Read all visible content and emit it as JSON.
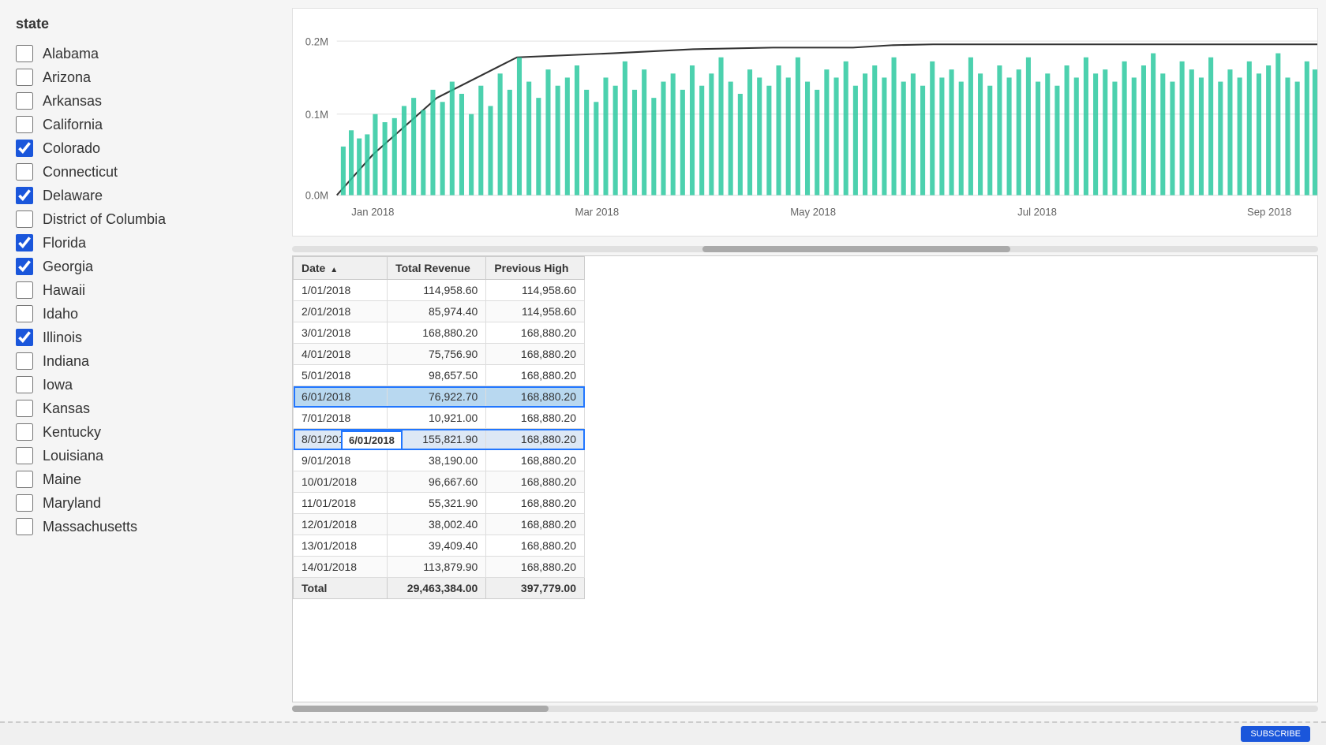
{
  "sidebar": {
    "title": "state",
    "states": [
      {
        "label": "Alabama",
        "checked": false
      },
      {
        "label": "Arizona",
        "checked": false
      },
      {
        "label": "Arkansas",
        "checked": false
      },
      {
        "label": "California",
        "checked": false
      },
      {
        "label": "Colorado",
        "checked": true
      },
      {
        "label": "Connecticut",
        "checked": false
      },
      {
        "label": "Delaware",
        "checked": true
      },
      {
        "label": "District of Columbia",
        "checked": false
      },
      {
        "label": "Florida",
        "checked": true
      },
      {
        "label": "Georgia",
        "checked": true
      },
      {
        "label": "Hawaii",
        "checked": false
      },
      {
        "label": "Idaho",
        "checked": false
      },
      {
        "label": "Illinois",
        "checked": true
      },
      {
        "label": "Indiana",
        "checked": false
      },
      {
        "label": "Iowa",
        "checked": false
      },
      {
        "label": "Kansas",
        "checked": false
      },
      {
        "label": "Kentucky",
        "checked": false
      },
      {
        "label": "Louisiana",
        "checked": false
      },
      {
        "label": "Maine",
        "checked": false
      },
      {
        "label": "Maryland",
        "checked": false
      },
      {
        "label": "Massachusetts",
        "checked": false
      }
    ]
  },
  "chart": {
    "yLabels": [
      "0.2M",
      "0.1M",
      "0.0M"
    ],
    "xLabels": [
      "Jan 2018",
      "Mar 2018",
      "May 2018",
      "Jul 2018",
      "Sep 2018"
    ]
  },
  "table": {
    "headers": [
      "Date",
      "Total Revenue",
      "Previous High"
    ],
    "rows": [
      {
        "date": "1/01/2018",
        "revenue": "114,958.60",
        "prev_high": "114,958.60"
      },
      {
        "date": "2/01/2018",
        "revenue": "85,974.40",
        "prev_high": "114,958.60"
      },
      {
        "date": "3/01/2018",
        "revenue": "168,880.20",
        "prev_high": "168,880.20"
      },
      {
        "date": "4/01/2018",
        "revenue": "75,756.90",
        "prev_high": "168,880.20"
      },
      {
        "date": "5/01/2018",
        "revenue": "98,657.50",
        "prev_high": "168,880.20"
      },
      {
        "date": "6/01/2018",
        "revenue": "76,922.70",
        "prev_high": "168,880.20",
        "selected": true
      },
      {
        "date": "7/01/2018",
        "revenue": "10,921.00",
        "prev_high": "168,880.20"
      },
      {
        "date": "8/01/2018",
        "revenue": "155,821.90",
        "prev_high": "168,880.20",
        "tooltip": "6/01/2018"
      },
      {
        "date": "9/01/2018",
        "revenue": "38,190.00",
        "prev_high": "168,880.20"
      },
      {
        "date": "10/01/2018",
        "revenue": "96,667.60",
        "prev_high": "168,880.20"
      },
      {
        "date": "11/01/2018",
        "revenue": "55,321.90",
        "prev_high": "168,880.20"
      },
      {
        "date": "12/01/2018",
        "revenue": "38,002.40",
        "prev_high": "168,880.20"
      },
      {
        "date": "13/01/2018",
        "revenue": "39,409.40",
        "prev_high": "168,880.20"
      },
      {
        "date": "14/01/2018",
        "revenue": "113,879.90",
        "prev_high": "168,880.20"
      }
    ],
    "footer": {
      "label": "Total",
      "revenue": "29,463,384.00",
      "prev_high": "397,779.00"
    }
  }
}
